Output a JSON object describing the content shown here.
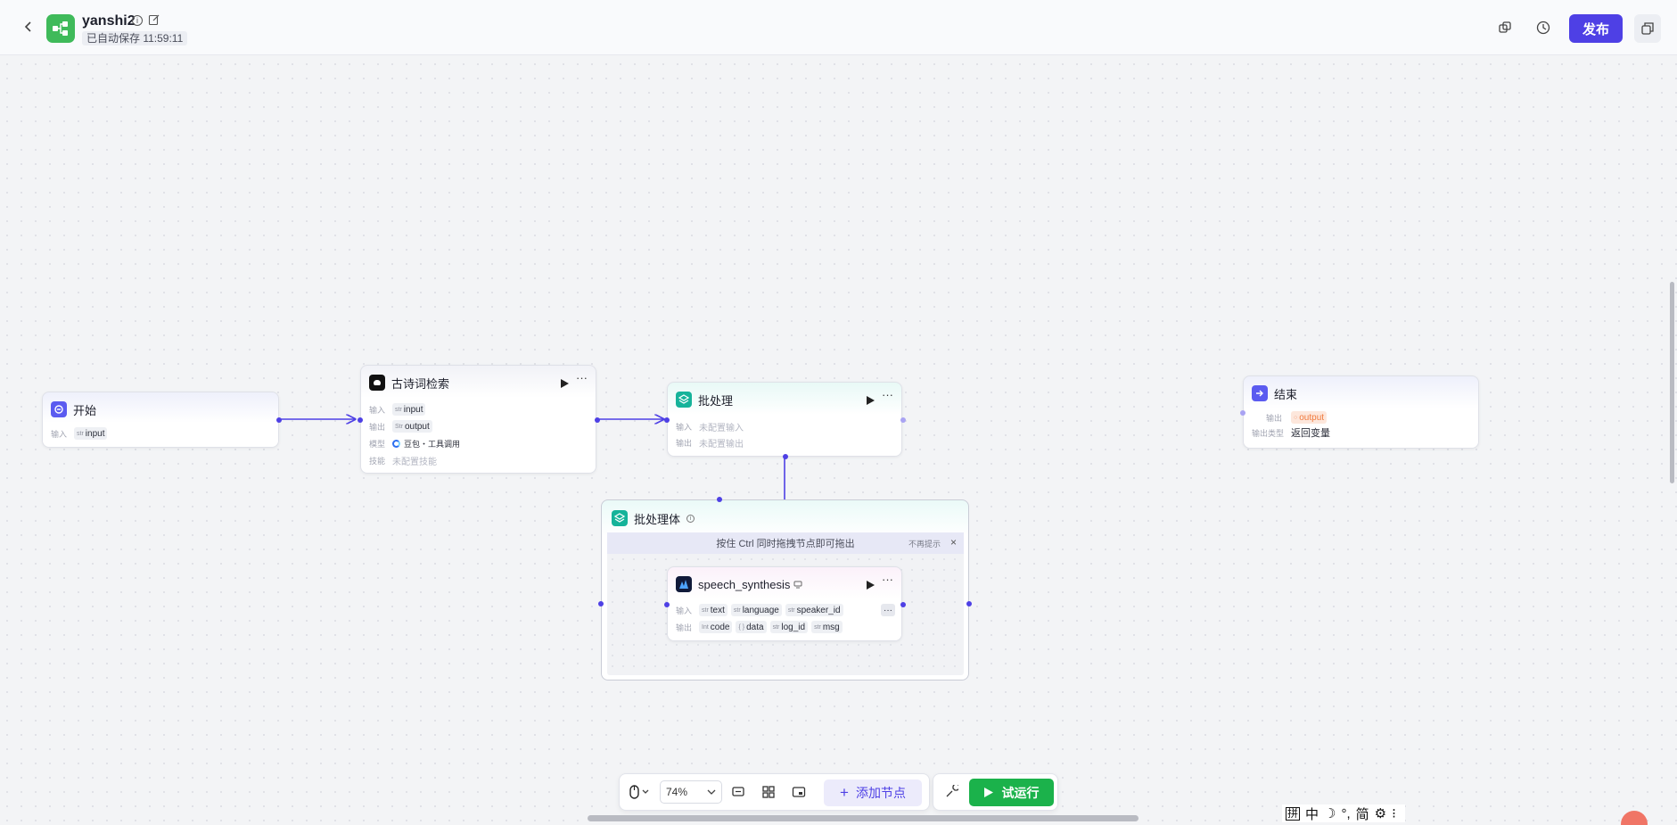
{
  "header": {
    "app_name": "yanshi2",
    "save_status": "已自动保存 11:59:11",
    "publish_label": "发布"
  },
  "nodes": {
    "start": {
      "title": "开始",
      "input_label": "输入",
      "input_type": "str",
      "input_value": "input"
    },
    "poetry": {
      "title": "古诗词检索",
      "input_label": "输入",
      "input_type": "str",
      "input_value": "input",
      "output_label": "输出",
      "output_type": "Str",
      "output_value": "output",
      "model_label": "模型",
      "model_value": "豆包・工具调用",
      "skill_label": "技能",
      "skill_value": "未配置技能"
    },
    "batch": {
      "title": "批处理",
      "input_label": "输入",
      "input_value": "未配置输入",
      "output_label": "输出",
      "output_value": "未配置输出"
    },
    "batch_body": {
      "title": "批处理体",
      "hint": "按住 Ctrl 同时拖拽节点即可拖出",
      "dismiss": "不再提示"
    },
    "speech": {
      "title": "speech_synthesis",
      "input_label": "输入",
      "inputs": [
        {
          "type": "str",
          "name": "text"
        },
        {
          "type": "str",
          "name": "language"
        },
        {
          "type": "str",
          "name": "speaker_id"
        }
      ],
      "output_label": "输出",
      "outputs": [
        {
          "type": "Int",
          "name": "code"
        },
        {
          "type": "{ }",
          "name": "data"
        },
        {
          "type": "str",
          "name": "log_id"
        },
        {
          "type": "str",
          "name": "msg"
        }
      ]
    },
    "end": {
      "title": "结束",
      "output_label": "输出",
      "output_value": "output",
      "output_type_label": "输出类型",
      "output_type_value": "返回变量"
    }
  },
  "toolbar": {
    "zoom": "74%",
    "add_node_label": "添加节点",
    "trial_run_label": "试运行"
  },
  "ime": {
    "items": [
      "拼",
      "中",
      "☽",
      "°,",
      "简",
      "⚙",
      "⁝"
    ]
  },
  "colors": {
    "accent": "#4e40e5",
    "run_green": "#1bb24b",
    "app_icon": "#3fba5a"
  }
}
